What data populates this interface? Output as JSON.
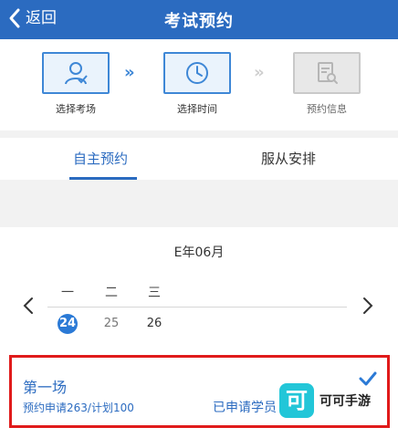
{
  "navbar": {
    "back_label": "返回",
    "title": "考试预约",
    "bg_color": "#2b6bc0"
  },
  "steps": [
    {
      "label": "选择考场",
      "state": "active",
      "icon": "user-icon"
    },
    {
      "label": "选择时间",
      "state": "active",
      "icon": "clock-icon"
    },
    {
      "label": "预约信息",
      "state": "inactive",
      "icon": "document-search-icon"
    }
  ],
  "step_arrows": [
    "»",
    "»"
  ],
  "tabs": [
    {
      "label": "自主预约",
      "active": true
    },
    {
      "label": "服从安排",
      "active": false
    }
  ],
  "calendar": {
    "month_label": "E年06月",
    "weekdays": [
      "一",
      "二",
      "三"
    ],
    "days": [
      {
        "label": "24",
        "selected": true
      },
      {
        "label": "25",
        "selected": false
      },
      {
        "label": "26",
        "selected": false
      }
    ]
  },
  "session": {
    "title": "第一场",
    "quota": "预约申请263/计划100",
    "applied": "已申请学员",
    "checked": true
  },
  "watermark": {
    "logo_char": "可",
    "text": "可可手游"
  },
  "colors": {
    "accent": "#2b6bc0",
    "highlight_border": "#e01b1b",
    "watermark_logo": "#22c6d8"
  }
}
